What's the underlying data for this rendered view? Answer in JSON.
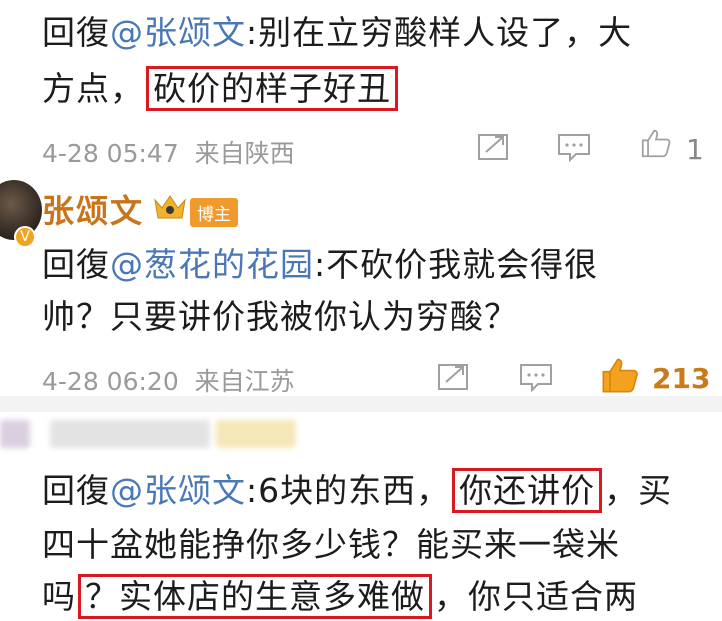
{
  "comments": [
    {
      "prefix": "回復",
      "mention": "@张颂文",
      "line1_rest": ":别在立穷酸样人设了，大",
      "line2_pre": "方点，",
      "line2_highlight": "砍价的样子好丑",
      "time": "4-28 05:47",
      "source": "来自陕西",
      "likes": "1"
    },
    {
      "author": "张颂文",
      "badge": "博主",
      "prefix": "回復",
      "mention": "@葱花的花园",
      "line1_rest": ":不砍价我就会得很",
      "line2": "帅？只要讲价我被你认为穷酸？",
      "time": "4-28 06:20",
      "source": "来自江苏",
      "likes": "213"
    },
    {
      "prefix": "回復",
      "mention": "@张颂文",
      "line1_mid": ":6块的东西，",
      "line1_highlight": "你还讲价",
      "line1_end": "，买",
      "line2": "四十盆她能挣你多少钱？能买来一袋米",
      "line3_pre": "吗",
      "line3_highlight": "？实体店的生意多难做",
      "line3_end": "，你只适合两"
    }
  ],
  "colors": {
    "mention": "#4a78b6",
    "author": "#c9741a",
    "highlight_border": "#d8191f",
    "meta": "#9a9a9a",
    "badge": "#f09a2e"
  },
  "icons": [
    "share-icon",
    "comment-icon",
    "like-icon"
  ]
}
